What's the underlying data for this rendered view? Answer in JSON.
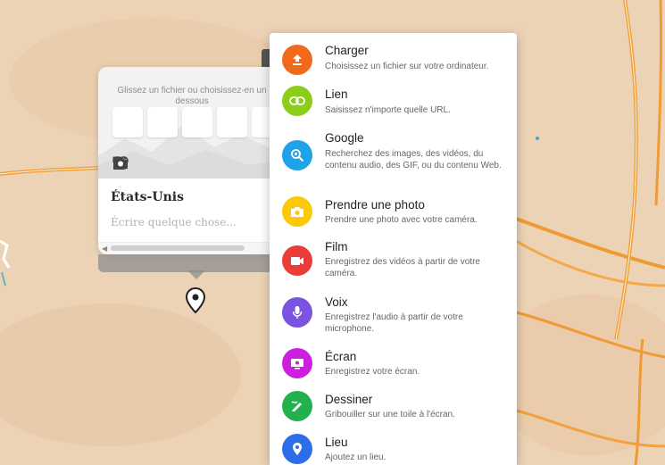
{
  "card": {
    "drop_hint": "Glissez un fichier ou choisissez-en un dessous",
    "title": "États-Unis",
    "body_placeholder": "Écrire quelque chose...",
    "tools": [
      {
        "icon": "upload-icon"
      },
      {
        "icon": "link-icon"
      },
      {
        "icon": "search-icon"
      },
      {
        "icon": "camera-icon"
      },
      {
        "icon": "more-icon"
      }
    ]
  },
  "menu": {
    "items": [
      {
        "label": "Charger",
        "description": "Choisissez un fichier sur votre ordinateur.",
        "icon": "upload-icon",
        "color": "#f06a1a"
      },
      {
        "label": "Lien",
        "description": "Saisissez n'importe quelle URL.",
        "icon": "link-icon",
        "color": "#8ccd17"
      },
      {
        "label": "Google",
        "description": "Recherchez des images, des vidéos, du contenu audio, des GIF, ou du contenu Web.",
        "icon": "google-search-icon",
        "color": "#1fa3e8"
      },
      {
        "label": "Prendre une photo",
        "description": "Prendre une photo avec votre caméra.",
        "icon": "camera-icon",
        "color": "#fbc908"
      },
      {
        "label": "Film",
        "description": "Enregistrez des vidéos à partir de votre caméra.",
        "icon": "video-camera-icon",
        "color": "#ea3c38"
      },
      {
        "label": "Voix",
        "description": "Enregistrez l'audio à partir de votre microphone.",
        "icon": "microphone-icon",
        "color": "#7b53e0"
      },
      {
        "label": "Écran",
        "description": "Enregistrez votre écran.",
        "icon": "screen-record-icon",
        "color": "#cc1fe0"
      },
      {
        "label": "Dessiner",
        "description": "Gribouiller sur une toile à l'écran.",
        "icon": "draw-icon",
        "color": "#23b14d"
      },
      {
        "label": "Lieu",
        "description": "Ajoutez un lieu.",
        "icon": "location-pin-icon",
        "color": "#2d6ee8"
      }
    ]
  }
}
